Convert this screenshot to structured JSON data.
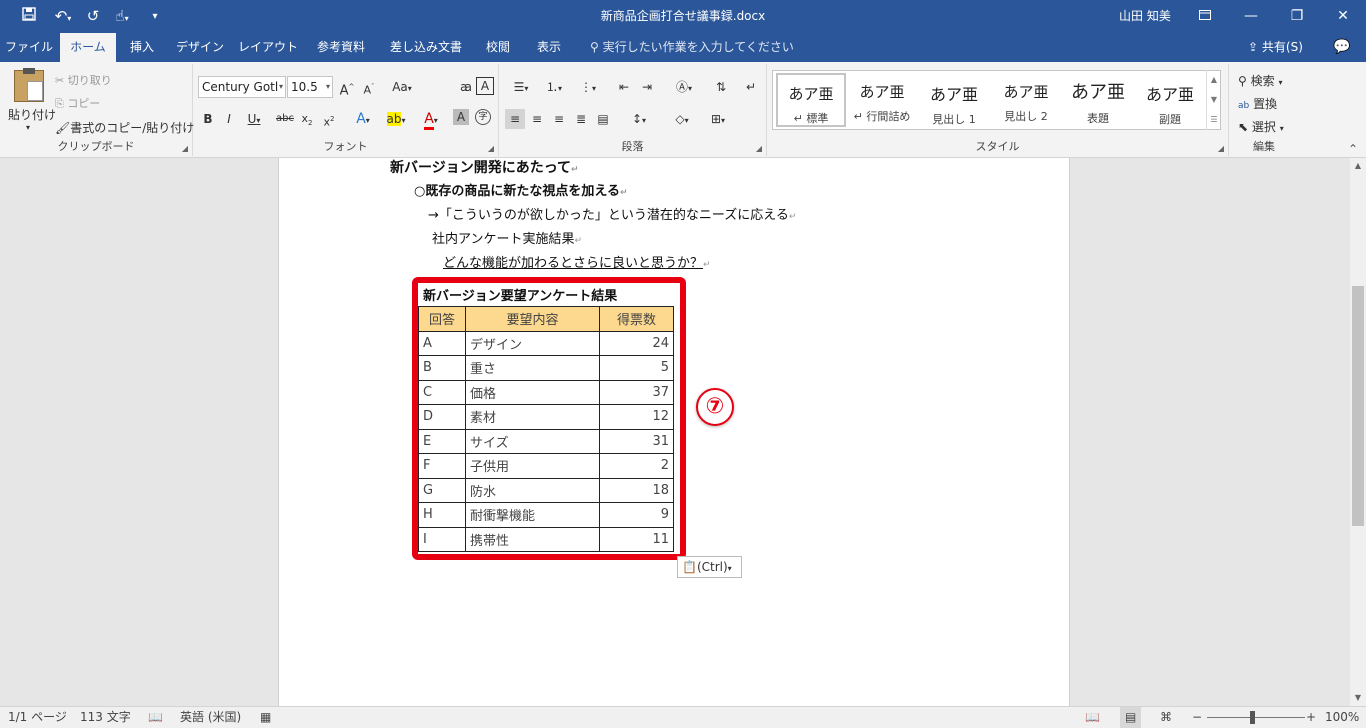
{
  "titlebar": {
    "doc_title": "新商品企画打合せ議事録.docx",
    "user": "山田 知美",
    "save_icon": "save-icon",
    "undo_icon": "undo-icon",
    "redo_icon": "redo-icon",
    "touch_icon": "touch-mode-icon"
  },
  "tabs": [
    "ファイル",
    "ホーム",
    "挿入",
    "デザイン",
    "レイアウト",
    "参考資料",
    "差し込み文書",
    "校閲",
    "表示"
  ],
  "active_tab": "ホーム",
  "tell_me": "実行したい作業を入力してください",
  "share": "共有(S)",
  "ribbon": {
    "clipboard": {
      "label": "クリップボード",
      "paste": "貼り付け",
      "cut": "切り取り",
      "copy": "コピー",
      "format_painter": "書式のコピー/貼り付け"
    },
    "font": {
      "label": "フォント",
      "font_name": "Century Gotl",
      "font_size": "10.5",
      "aa": "Aa"
    },
    "paragraph": {
      "label": "段落"
    },
    "styles": {
      "label": "スタイル",
      "items": [
        {
          "preview": "あア亜",
          "name": "↵ 標準"
        },
        {
          "preview": "あア亜",
          "name": "↵ 行間詰め"
        },
        {
          "preview": "あア亜",
          "name": "見出し 1"
        },
        {
          "preview": "あア亜",
          "name": "見出し 2"
        },
        {
          "preview": "あア亜",
          "name": "表題"
        },
        {
          "preview": "あア亜",
          "name": "副題"
        }
      ]
    },
    "editing": {
      "label": "編集",
      "find": "検索",
      "replace": "置換",
      "select": "選択"
    }
  },
  "document": {
    "heading": "新バージョン開発にあたって",
    "bullet": "○既存の商品に新たな視点を加える",
    "arrow_line": "→「こういうのが欲しかった」という潜在的なニーズに応える",
    "survey": "社内アンケート実施結果",
    "question": "どんな機能が加わるとさらに良いと思うか？",
    "table_title": "新バージョン要望アンケート結果",
    "table_headers": [
      "回答",
      "要望内容",
      "得票数"
    ],
    "table_rows": [
      [
        "A",
        "デザイン",
        "24"
      ],
      [
        "B",
        "重さ",
        "5"
      ],
      [
        "C",
        "価格",
        "37"
      ],
      [
        "D",
        "素材",
        "12"
      ],
      [
        "E",
        "サイズ",
        "31"
      ],
      [
        "F",
        "子供用",
        "2"
      ],
      [
        "G",
        "防水",
        "18"
      ],
      [
        "H",
        "耐衝撃機能",
        "9"
      ],
      [
        "I",
        "携帯性",
        "11"
      ]
    ]
  },
  "annotation": {
    "step": "⑦",
    "highlight_color": "#e60012"
  },
  "paste_options": "(Ctrl)",
  "status": {
    "page": "1/1 ページ",
    "words": "113 文字",
    "language": "英語 (米国)",
    "zoom": "100%"
  },
  "colors": {
    "accent": "#2b579a",
    "table_header": "#fcd98e"
  }
}
